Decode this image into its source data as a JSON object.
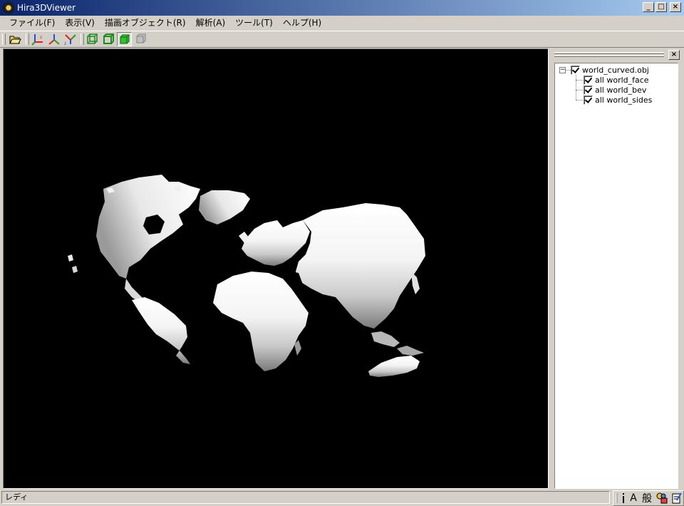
{
  "window": {
    "title": "Hira3DViewer"
  },
  "title_buttons": {
    "minimize": "_",
    "maximize": "□",
    "close": "×"
  },
  "menu": [
    "ファイル(F)",
    "表示(V)",
    "描画オブジェクト(R)",
    "解析(A)",
    "ツール(T)",
    "ヘルプ(H)"
  ],
  "toolbar": {
    "buttons": [
      "open-folder-icon",
      "axis-xy-icon",
      "axis-yz-icon",
      "axis-xz-icon",
      "wireframe-cube-icon",
      "shaded-cube-icon",
      "solid-green-cube-icon",
      "disabled-cube-icon"
    ]
  },
  "panel": {
    "close_label": "×"
  },
  "tree": {
    "expander": "−",
    "root": "world_curved.obj",
    "children": [
      "all world_face",
      "all world_bev",
      "all world_sides"
    ]
  },
  "status": {
    "text": "レディ"
  },
  "ime": {
    "mode_a": "A",
    "mode_kanji": "般"
  },
  "colors": {
    "title_gradient_start": "#0a246a",
    "title_gradient_end": "#a6caf0",
    "viewport_bg": "#000000",
    "chrome": "#d4d0c8"
  }
}
